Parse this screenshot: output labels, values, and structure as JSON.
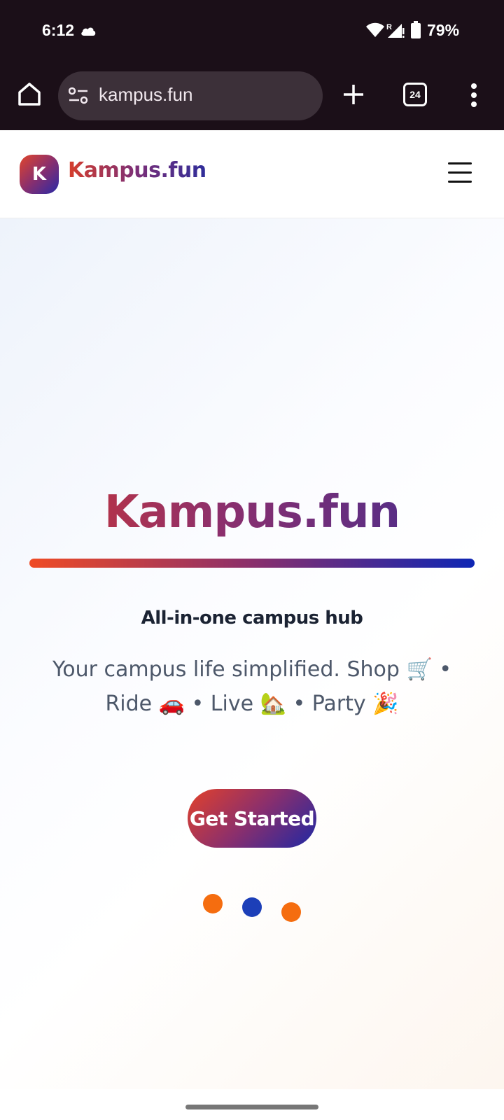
{
  "status_bar": {
    "time": "6:12",
    "battery": "79%",
    "icons": [
      "cloud-icon",
      "wifi-icon",
      "signal-icon",
      "battery-icon"
    ]
  },
  "browser": {
    "url": "kampus.fun",
    "tab_count": "24",
    "icons": [
      "home-icon",
      "tune-icon",
      "plus-icon",
      "tabs-icon",
      "more-vert-icon"
    ]
  },
  "header": {
    "logo_letter": "K",
    "brand": "Kampus.fun",
    "menu_icon": "hamburger-icon"
  },
  "hero": {
    "title": "Kampus.fun",
    "tagline": "All-in-one campus hub",
    "description": "Your campus life simplified. Shop 🛒 • Ride 🚗 • Live 🏡 • Party 🎉",
    "cta_label": "Get Started",
    "colors": {
      "accent_orange": "#f56d0f",
      "accent_blue": "#1c3fb8",
      "brand_red": "#d3362e",
      "brand_purple": "#3b2c93"
    }
  }
}
